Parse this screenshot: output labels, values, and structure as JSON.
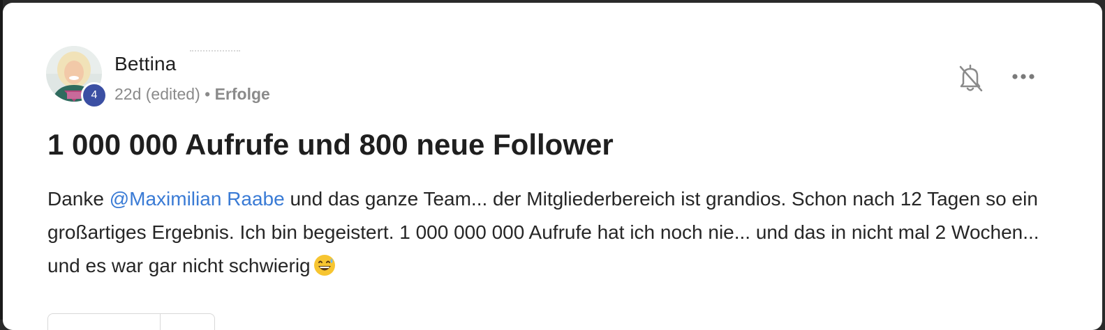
{
  "post": {
    "author_name": "Bettina",
    "level": "4",
    "time_ago": "22d",
    "edited_label": "(edited)",
    "separator": "•",
    "category": "Erfolge",
    "title": "1 000 000 Aufrufe und 800 neue Follower",
    "body": {
      "before_mention": "Danke ",
      "mention": "@Maximilian Raabe",
      "after_mention": " und das ganze Team... der Mitgliederbereich ist grandios. Schon nach 12 Tagen so ein großartiges Ergebnis. Ich bin begeistert. 1 000 000 000 Aufrufe hat ich noch nie... und das in nicht mal 2 Wochen... und es war gar nicht schwierig"
    }
  },
  "icons": {
    "bell": "bell-off-icon",
    "more": "more-horizontal-icon",
    "emoji": "grinning-sweat-emoji"
  },
  "colors": {
    "mention": "#3a7bd5",
    "level_badge": "#3b4fa3",
    "meta_text": "#8a8a8a"
  }
}
